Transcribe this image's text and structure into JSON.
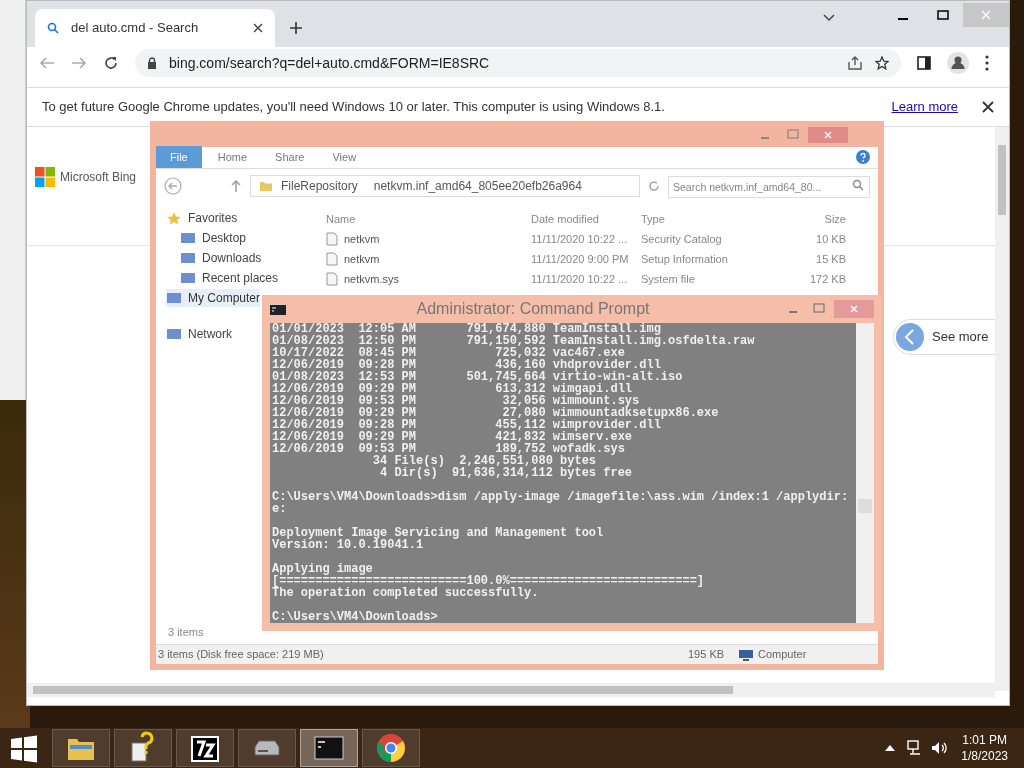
{
  "browser": {
    "tab_title": "del auto.cmd - Search",
    "url": "bing.com/search?q=del+auto.cmd&FORM=IE8SRC",
    "infobar": {
      "message": "To get future Google Chrome updates, you'll need Windows 10 or later. This computer is using Windows 8.1.",
      "link": "Learn more"
    },
    "page": {
      "logo": "Microsoft Bing",
      "see_more": "See more"
    }
  },
  "explorer": {
    "ribbon_tabs": [
      {
        "label": "File",
        "selected": true
      },
      {
        "label": "Home",
        "selected": false
      },
      {
        "label": "Share",
        "selected": false
      },
      {
        "label": "View",
        "selected": false
      }
    ],
    "breadcrumb": [
      "FileRepository",
      "netkvm.inf_amd64_805ee20efb26a964"
    ],
    "search_placeholder": "Search netkvm.inf_amd64_80...",
    "columns": [
      "Name",
      "Date modified",
      "Type",
      "Size"
    ],
    "rows": [
      {
        "name": "netkvm",
        "date": "11/11/2020 10:22 ...",
        "type": "Security Catalog",
        "size": "10 KB"
      },
      {
        "name": "netkvm",
        "date": "11/11/2020 9:00 PM",
        "type": "Setup Information",
        "size": "15 KB"
      },
      {
        "name": "netkvm.sys",
        "date": "11/11/2020 10:22 ...",
        "type": "System file",
        "size": "172 KB"
      }
    ],
    "nav": [
      {
        "label": "Favorites",
        "selected": false,
        "children": [
          {
            "label": "Desktop",
            "selected": false
          },
          {
            "label": "Downloads",
            "selected": false
          },
          {
            "label": "Recent places",
            "selected": false
          }
        ]
      },
      {
        "label": "My Computer",
        "selected": true
      },
      {
        "label": "Network",
        "selected": false
      }
    ],
    "status": "3 items",
    "status_bar": [
      "3 items (Disk free space: 219 MB)",
      "195 KB",
      "Computer"
    ]
  },
  "cmd": {
    "title": "Administrator:  Command Prompt",
    "blocks": [
      [
        "01/01/2023  12:05 AM       791,674,880 TeamInstall.img",
        "01/08/2023  12:50 PM       791,150,592 TeamInstall.img.osfdelta.raw",
        "10/17/2022  08:45 PM           725,032 vac467.exe",
        "12/06/2019  09:28 PM           436,160 vhdprovider.dll",
        "01/08/2023  12:53 PM       501,745,664 virtio-win-alt.iso",
        "12/06/2019  09:29 PM           613,312 wimgapi.dll",
        "12/06/2019  09:53 PM            32,056 wimmount.sys",
        "12/06/2019  09:29 PM            27,080 wimmountadksetupx86.exe",
        "12/06/2019  09:28 PM           455,112 wimprovider.dll",
        "12/06/2019  09:29 PM           421,832 wimserv.exe",
        "12/06/2019  09:53 PM           189,752 wofadk.sys",
        "              34 File(s)  2,246,551,080 bytes",
        "               4 Dir(s)  91,636,314,112 bytes free"
      ],
      [
        "C:\\Users\\VM4\\Downloads>dism /apply-image /imagefile:\\ass.wim /index:1 /applydir:",
        "e:"
      ],
      [
        "Deployment Image Servicing and Management tool",
        "Version: 10.0.19041.1"
      ],
      [
        "Applying image",
        "[==========================100.0%==========================]",
        "The operation completed successfully."
      ],
      [
        "C:\\Users\\VM4\\Downloads>"
      ]
    ]
  },
  "taskbar": {
    "apps": [
      {
        "kind": "start",
        "active": false
      },
      {
        "kind": "explorer",
        "active": false
      },
      {
        "kind": "help",
        "active": false
      },
      {
        "kind": "archiver",
        "active": false
      },
      {
        "kind": "drive",
        "active": false
      },
      {
        "kind": "cmd",
        "active": true
      },
      {
        "kind": "chrome",
        "active": false
      }
    ],
    "time": "1:01 PM",
    "date": "1/8/2023"
  }
}
